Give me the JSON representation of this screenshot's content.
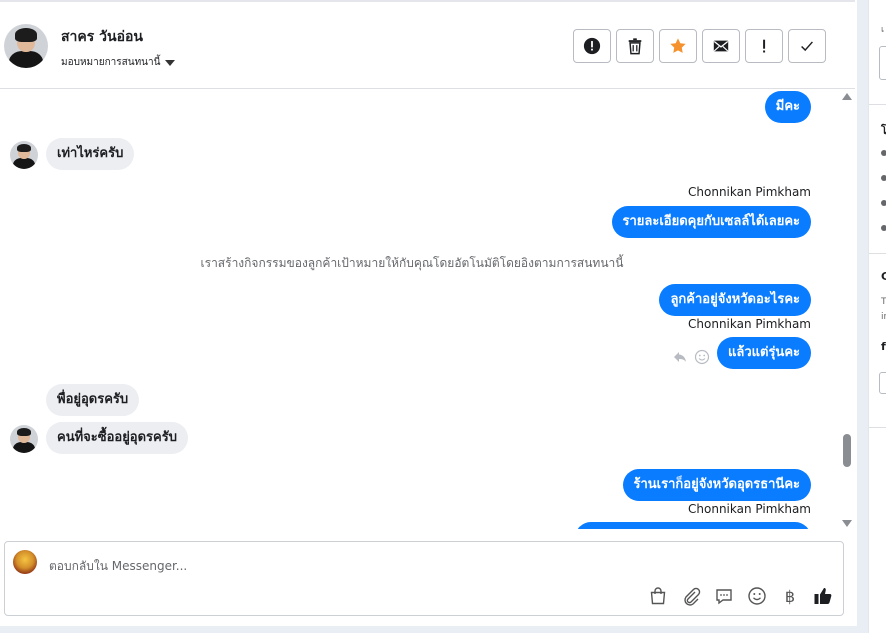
{
  "header": {
    "name": "สาคร วันอ่อน",
    "assign_label": "มอบหมายการสนทนานี้",
    "tool_icons": [
      "report-icon",
      "trash-icon",
      "star-icon",
      "mail-icon",
      "exclamation-icon",
      "check-icon"
    ]
  },
  "messages": {
    "m1": "มีคะ",
    "m2": "เท่าไหร่ครับ",
    "s1": "Chonnikan Pimkham",
    "m3": "รายละเอียดคุยกับเซลล์ได้เลยคะ",
    "sys": "เราสร้างกิจกรรมของลูกค้าเป้าหมายให้กับคุณโดยอัตโนมัติโดยอิงตามการสนทนานี้",
    "m4": "ลูกค้าอยู่จังหวัดอะไรคะ",
    "s2": "Chonnikan Pimkham",
    "m5": "แล้วแต่รุ่นคะ",
    "m6": "พื่อยู่อุดรครับ",
    "m7": "คนที่จะซื้ออยู่อุดรครับ",
    "m8": "ร้านเราก็อยู่จังหวัดอุดรธานีคะ",
    "s3": "Chonnikan Pimkham"
  },
  "composer": {
    "placeholder": "ตอบกลับใน Messenger...",
    "icons": [
      "bag-icon",
      "attach-icon",
      "chat-bubble-icon",
      "emoji-icon",
      "baht-icon",
      "like-icon"
    ]
  },
  "colors": {
    "accent": "#0a7cff",
    "incoming": "#eceef1",
    "star": "#f5922e"
  }
}
